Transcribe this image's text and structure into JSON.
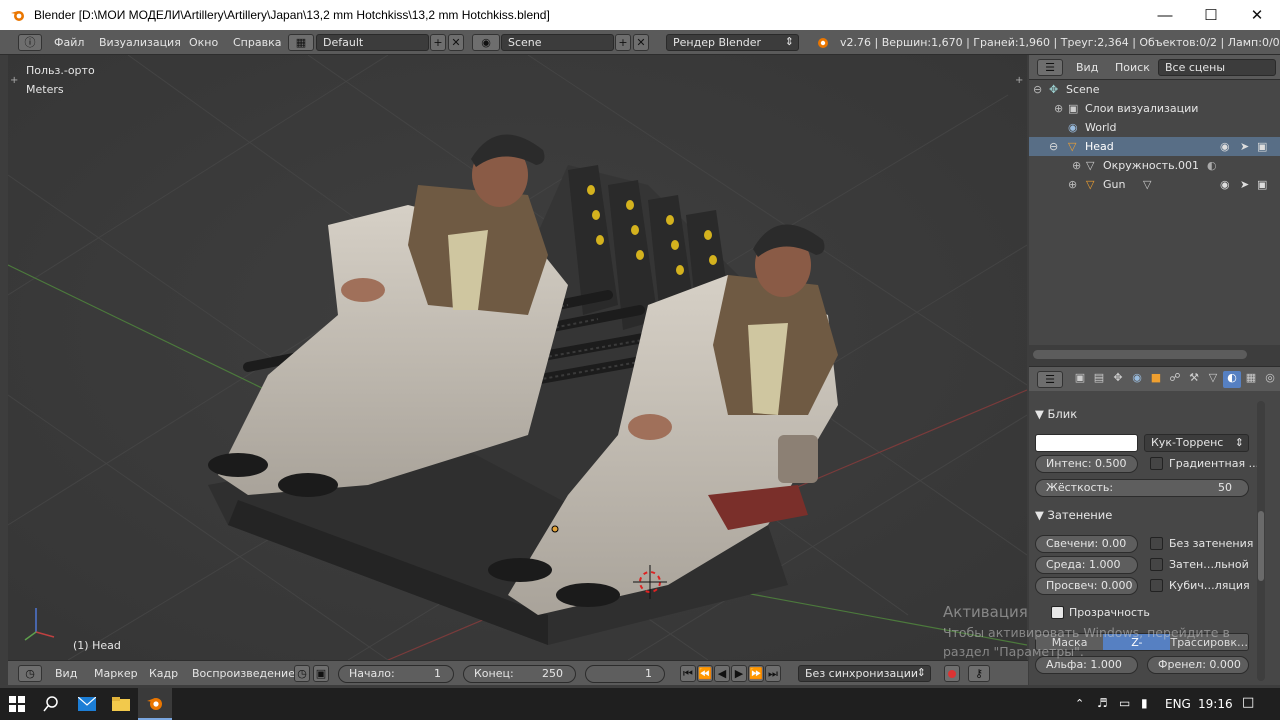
{
  "window": {
    "title": "Blender [D:\\МОИ МОДЕЛИ\\Artillery\\Artillery\\Japan\\13,2 mm Hotchkiss\\13,2 mm Hotchkiss.blend]"
  },
  "menu": {
    "items": [
      "Файл",
      "Визуализация",
      "Окно",
      "Справка"
    ],
    "screen_layout": "Default",
    "scene": "Scene",
    "render_engine": "Рендер Blender",
    "stats": "v2.76 | Вершин:1,670 | Граней:1,960 | Треуг:2,364 | Объектов:0/2 | Ламп:0/0 | Пам.:28."
  },
  "viewport": {
    "view_name": "Польз.-орто",
    "units": "Meters",
    "active_object": "(1) Head",
    "watermark_title": "Активация Windows",
    "watermark_line1": "Чтобы активировать Windows, перейдите в",
    "watermark_line2": "раздел \"Параметры\"."
  },
  "outliner": {
    "header": {
      "view": "Вид",
      "search": "Поиск",
      "filter": "Все сцены"
    },
    "rows": [
      {
        "label": "Scene"
      },
      {
        "label": "Слои визуализации"
      },
      {
        "label": "World"
      },
      {
        "label": "Head"
      },
      {
        "label": "Окружность.001"
      },
      {
        "label": "Gun"
      }
    ]
  },
  "properties": {
    "specular": {
      "title": "Блик",
      "shader": "Кук-Торренс",
      "intensity_label": "Интенс:",
      "intensity": "0.500",
      "ramp_label": "Градиентная ...",
      "hardness_label": "Жёсткость:",
      "hardness": "50"
    },
    "shading": {
      "title": "Затенение",
      "emit_label": "Свечени:",
      "emit": "0.00",
      "ambient_label": "Среда:",
      "ambient": "1.000",
      "translucency_label": "Просвеч:",
      "translucency": "0.000",
      "shadeless": "Без затенения",
      "tangent": "Затен…льной",
      "cubic": "Кубич…ляция"
    },
    "transparency": {
      "title": "Прозрачность",
      "tabs": [
        "Маска",
        "Z-прозрачн…",
        "Трассировк…"
      ],
      "alpha_label": "Альфа:",
      "alpha": "1.000",
      "fresnel_label": "Френел:",
      "fresnel": "0.000"
    }
  },
  "timeline": {
    "menu": [
      "Вид",
      "Маркер",
      "Кадр",
      "Воспроизведение"
    ],
    "start_label": "Начало:",
    "start": "1",
    "end_label": "Конец:",
    "end": "250",
    "current": "1",
    "sync": "Без синхронизации"
  },
  "taskbar": {
    "lang": "ENG",
    "time": "19:16"
  },
  "colors": {
    "accent": "#5680c2",
    "selected_row": "#586e86",
    "grid_x": "#7a3b3b",
    "grid_y": "#4c7a3c"
  }
}
